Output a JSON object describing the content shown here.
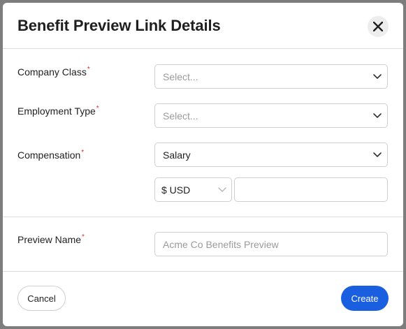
{
  "modal": {
    "title": "Benefit Preview Link Details",
    "close_icon": "close-icon"
  },
  "form": {
    "company_class": {
      "label": "Company Class",
      "required": "*",
      "placeholder": "Select..."
    },
    "employment_type": {
      "label": "Employment Type",
      "required": "*",
      "placeholder": "Select..."
    },
    "compensation": {
      "label": "Compensation",
      "required": "*",
      "value": "Salary"
    },
    "currency": {
      "value": "$ USD"
    },
    "amount": {
      "value": ""
    },
    "preview_name": {
      "label": "Preview Name",
      "required": "*",
      "placeholder": "Acme Co Benefits Preview"
    }
  },
  "footer": {
    "cancel_label": "Cancel",
    "create_label": "Create"
  },
  "colors": {
    "primary": "#1a5fe0",
    "required": "#d93025",
    "backdrop": "#7d7d7d"
  }
}
